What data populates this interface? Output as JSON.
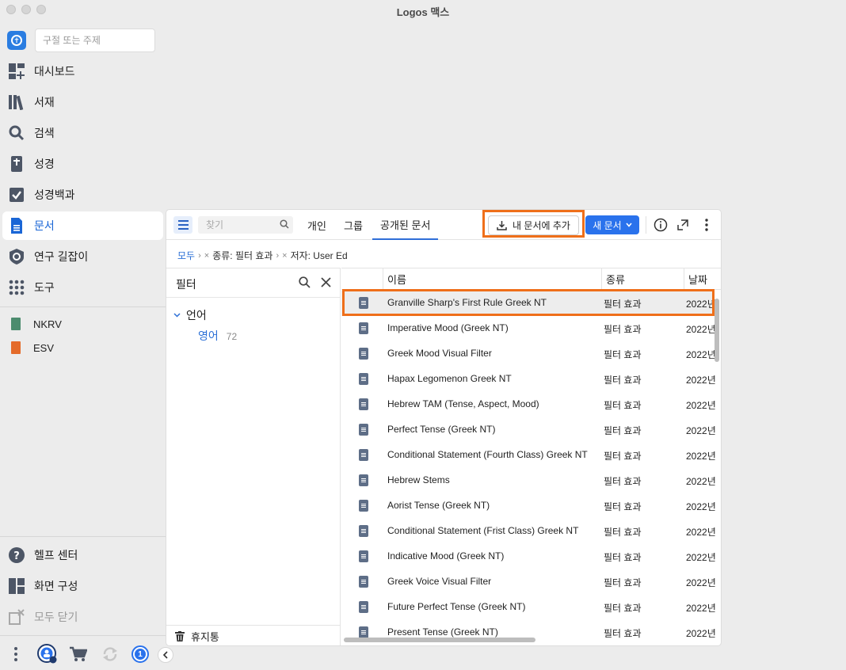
{
  "window": {
    "title": "Logos 맥스"
  },
  "sidebar": {
    "search_placeholder": "구절 또는 주제",
    "nav": [
      {
        "label": "대시보드",
        "icon": "dashboard-icon"
      },
      {
        "label": "서재",
        "icon": "library-icon"
      },
      {
        "label": "검색",
        "icon": "search-icon"
      },
      {
        "label": "성경",
        "icon": "bible-icon"
      },
      {
        "label": "성경백과",
        "icon": "factbook-icon"
      },
      {
        "label": "문서",
        "icon": "document-icon",
        "active": true
      },
      {
        "label": "연구 길잡이",
        "icon": "guide-icon"
      },
      {
        "label": "도구",
        "icon": "tools-grid-icon"
      }
    ],
    "books": [
      {
        "label": "NKRV",
        "color": "#4c8c6e"
      },
      {
        "label": "ESV",
        "color": "#e46b2a"
      }
    ],
    "bottom_nav": [
      {
        "label": "헬프 센터",
        "icon": "help-icon"
      },
      {
        "label": "화면 구성",
        "icon": "layout-icon"
      },
      {
        "label": "모두 닫기",
        "icon": "close-all-icon",
        "disabled": true
      }
    ],
    "badge_count": "1"
  },
  "toolbar": {
    "find_placeholder": "찾기",
    "tabs": [
      "개인",
      "그룹",
      "공개된 문서"
    ],
    "add_label": "내 문서에 추가",
    "new_label": "새 문서"
  },
  "breadcrumb": {
    "root": "모두",
    "items": [
      "종류: 필터 효과",
      "저자: User Ed"
    ]
  },
  "filter": {
    "title": "필터",
    "group": "언어",
    "value": "영어",
    "count": "72",
    "trash_label": "휴지통"
  },
  "table": {
    "columns": [
      "이름",
      "종류",
      "날짜"
    ],
    "rows": [
      {
        "name": "Granville Sharp's First Rule Greek NT",
        "type": "필터 효과",
        "date": "2022년"
      },
      {
        "name": "Imperative Mood (Greek NT)",
        "type": "필터 효과",
        "date": "2022년"
      },
      {
        "name": "Greek Mood Visual Filter",
        "type": "필터 효과",
        "date": "2022년"
      },
      {
        "name": "Hapax Legomenon Greek NT",
        "type": "필터 효과",
        "date": "2022년"
      },
      {
        "name": "Hebrew TAM (Tense, Aspect, Mood)",
        "type": "필터 효과",
        "date": "2022년"
      },
      {
        "name": "Perfect Tense (Greek NT)",
        "type": "필터 효과",
        "date": "2022년"
      },
      {
        "name": "Conditional Statement (Fourth Class) Greek NT",
        "type": "필터 효과",
        "date": "2022년"
      },
      {
        "name": "Hebrew Stems",
        "type": "필터 효과",
        "date": "2022년"
      },
      {
        "name": "Aorist Tense (Greek NT)",
        "type": "필터 효과",
        "date": "2022년"
      },
      {
        "name": "Conditional Statement (Frist Class) Greek NT",
        "type": "필터 효과",
        "date": "2022년"
      },
      {
        "name": "Indicative Mood (Greek NT)",
        "type": "필터 효과",
        "date": "2022년"
      },
      {
        "name": "Greek Voice Visual Filter",
        "type": "필터 효과",
        "date": "2022년"
      },
      {
        "name": "Future Perfect Tense (Greek NT)",
        "type": "필터 효과",
        "date": "2022년"
      },
      {
        "name": "Present Tense (Greek NT)",
        "type": "필터 효과",
        "date": "2022년"
      }
    ]
  }
}
